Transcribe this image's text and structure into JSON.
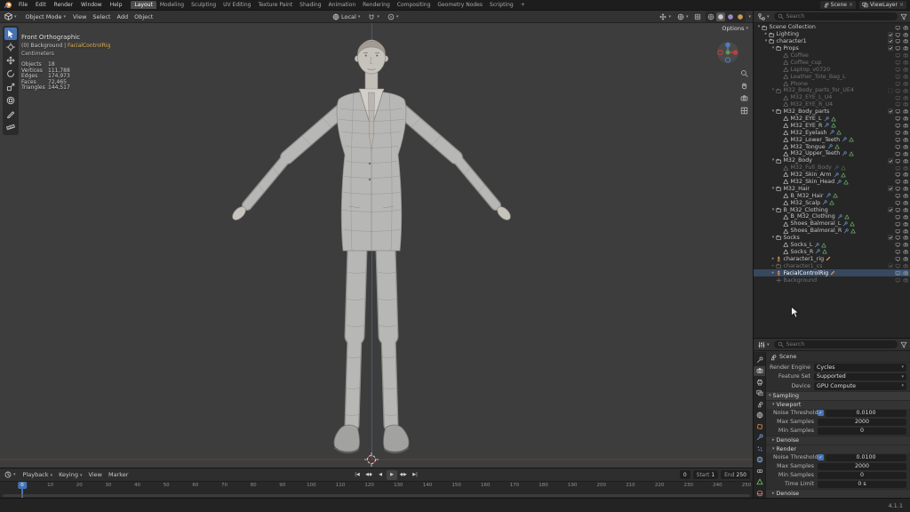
{
  "colors": {
    "accent": "#4772b3",
    "object_orange": "#e8954f",
    "modifier_blue": "#7aa5e0",
    "data_green": "#6fc96f",
    "material_pink": "#e07a7a",
    "selection_bg": "#4d73a6"
  },
  "topbar": {
    "menus": [
      "File",
      "Edit",
      "Render",
      "Window",
      "Help"
    ],
    "workspaces": [
      "Layout",
      "Modeling",
      "Sculpting",
      "UV Editing",
      "Texture Paint",
      "Shading",
      "Animation",
      "Rendering",
      "Compositing",
      "Geometry Nodes",
      "Scripting",
      "+"
    ],
    "active_workspace": "Layout",
    "scene_label": "Scene",
    "viewlayer_label": "ViewLayer"
  },
  "viewport_header": {
    "mode": "Object Mode",
    "menus": [
      "View",
      "Select",
      "Add",
      "Object"
    ],
    "orientation": "Local",
    "options_label": "Options"
  },
  "tools": [
    "select-box",
    "cursor",
    "move",
    "rotate",
    "scale",
    "transform",
    "annotate",
    "measure"
  ],
  "viewport": {
    "view_label": "Front Orthographic",
    "context_prefix": "(0) Background | ",
    "context_object": "FacialControlRig",
    "units_label": "Centimeters",
    "stats": [
      {
        "label": "Objects",
        "value": "18"
      },
      {
        "label": "Vertices",
        "value": "111,788"
      },
      {
        "label": "Edges",
        "value": "174,973"
      },
      {
        "label": "Faces",
        "value": "72,465"
      },
      {
        "label": "Triangles",
        "value": "144,517"
      }
    ]
  },
  "outliner": {
    "search_placeholder": "Search",
    "rows": [
      {
        "name": "Scene Collection",
        "d": 0,
        "t": "collection",
        "exp": "open"
      },
      {
        "name": "Lighting",
        "d": 1,
        "t": "collection",
        "exp": "closed",
        "check": true
      },
      {
        "name": "character1",
        "d": 1,
        "t": "collection",
        "exp": "open",
        "check": true
      },
      {
        "name": "Props",
        "d": 2,
        "t": "collection",
        "exp": "open",
        "check": true
      },
      {
        "name": "Coffee",
        "d": 3,
        "t": "mesh",
        "dim": true
      },
      {
        "name": "Coffee_cup",
        "d": 3,
        "t": "mesh",
        "dim": true
      },
      {
        "name": "Laptop_v0720",
        "d": 3,
        "t": "mesh",
        "dim": true
      },
      {
        "name": "Leather_Tote_Bag_L",
        "d": 3,
        "t": "mesh",
        "dim": true
      },
      {
        "name": "Phone",
        "d": 3,
        "t": "mesh",
        "dim": true
      },
      {
        "name": "M32_Body_parts_for_UE4",
        "d": 2,
        "t": "collection",
        "exp": "open",
        "dim": true,
        "check": false
      },
      {
        "name": "M32_EYE_L_U4",
        "d": 3,
        "t": "mesh",
        "dim": true
      },
      {
        "name": "M32_EYE_R_U4",
        "d": 3,
        "t": "mesh",
        "dim": true
      },
      {
        "name": "M32_Body_parts",
        "d": 2,
        "t": "collection",
        "exp": "open",
        "check": true
      },
      {
        "name": "M32_EYE_L",
        "d": 3,
        "t": "mesh",
        "badges": [
          "modifier",
          "data"
        ]
      },
      {
        "name": "M32_EYE_R",
        "d": 3,
        "t": "mesh",
        "badges": [
          "modifier",
          "data"
        ]
      },
      {
        "name": "M32_Eyelash",
        "d": 3,
        "t": "mesh",
        "badges": [
          "modifier",
          "data"
        ]
      },
      {
        "name": "M32_Lower_Teeth",
        "d": 3,
        "t": "mesh",
        "badges": [
          "modifier",
          "data"
        ]
      },
      {
        "name": "M32_Tongue",
        "d": 3,
        "t": "mesh",
        "badges": [
          "modifier",
          "data"
        ]
      },
      {
        "name": "M32_Upper_Teeth",
        "d": 3,
        "t": "mesh",
        "badges": [
          "modifier",
          "data"
        ]
      },
      {
        "name": "M32_Body",
        "d": 2,
        "t": "collection",
        "exp": "open",
        "check": true
      },
      {
        "name": "M32_Full_Body",
        "d": 3,
        "t": "mesh",
        "dim": true,
        "badges": [
          "modifier",
          "data"
        ]
      },
      {
        "name": "M32_Skin_Arm",
        "d": 3,
        "t": "mesh",
        "badges": [
          "modifier",
          "data"
        ]
      },
      {
        "name": "M32_Skin_Head",
        "d": 3,
        "t": "mesh",
        "badges": [
          "modifier",
          "data"
        ]
      },
      {
        "name": "M32_Hair",
        "d": 2,
        "t": "collection",
        "exp": "open",
        "check": true
      },
      {
        "name": "B_M32_Hair",
        "d": 3,
        "t": "mesh",
        "badges": [
          "modifier",
          "data"
        ]
      },
      {
        "name": "M32_Scalp",
        "d": 3,
        "t": "mesh",
        "badges": [
          "modifier",
          "data"
        ]
      },
      {
        "name": "B_M32_Clothing",
        "d": 2,
        "t": "collection",
        "exp": "open",
        "check": true
      },
      {
        "name": "B_M32_Clothing",
        "d": 3,
        "t": "mesh",
        "badges": [
          "modifier",
          "data"
        ]
      },
      {
        "name": "Shoes_Balmoral_L",
        "d": 3,
        "t": "mesh",
        "badges": [
          "modifier",
          "data"
        ]
      },
      {
        "name": "Shoes_Balmoral_R",
        "d": 3,
        "t": "mesh",
        "badges": [
          "modifier",
          "data"
        ]
      },
      {
        "name": "Socks",
        "d": 2,
        "t": "collection",
        "exp": "open",
        "check": true
      },
      {
        "name": "Socks_L",
        "d": 3,
        "t": "mesh",
        "badges": [
          "modifier",
          "data"
        ]
      },
      {
        "name": "Socks_R",
        "d": 3,
        "t": "mesh",
        "badges": [
          "modifier",
          "data"
        ]
      },
      {
        "name": "character1_rig",
        "d": 2,
        "t": "armature",
        "exp": "closed",
        "badges": [
          "pose"
        ]
      },
      {
        "name": "character1_cs",
        "d": 2,
        "t": "collection",
        "exp": "closed",
        "dim": true,
        "check": true
      },
      {
        "name": "FacialControlRig",
        "d": 2,
        "t": "armature",
        "exp": "closed",
        "sel": true,
        "badges": [
          "pose"
        ]
      },
      {
        "name": "Background",
        "d": 2,
        "t": "empty",
        "dim": true
      }
    ]
  },
  "properties": {
    "search_placeholder": "Search",
    "breadcrumb": "Scene",
    "active_tab": "render",
    "tabs": [
      {
        "id": "tool",
        "icon": "wrench",
        "color": "#b0b0b0"
      },
      {
        "id": "render",
        "icon": "camera",
        "color": "#c8c8c8"
      },
      {
        "id": "output",
        "icon": "printer",
        "color": "#b0b0b0"
      },
      {
        "id": "view-layer",
        "icon": "images",
        "color": "#b0b0b0"
      },
      {
        "id": "scene",
        "icon": "scene",
        "color": "#b0b0b0"
      },
      {
        "id": "world",
        "icon": "globe",
        "color": "#b0b0b0"
      },
      {
        "id": "object",
        "icon": "object",
        "color": "#e8954f"
      },
      {
        "id": "modifiers",
        "icon": "wrench",
        "color": "#7aa5e0"
      },
      {
        "id": "particles",
        "icon": "particles",
        "color": "#7aa5e0"
      },
      {
        "id": "physics",
        "icon": "physics",
        "color": "#7aa5e0"
      },
      {
        "id": "constraints",
        "icon": "constraints",
        "color": "#b0b0b0"
      },
      {
        "id": "data",
        "icon": "mesh",
        "color": "#6fc96f"
      },
      {
        "id": "material",
        "icon": "material",
        "color": "#e07a7a"
      }
    ],
    "config_rows": [
      {
        "label": "Render Engine",
        "value": "Cycles",
        "dropdown": true
      },
      {
        "label": "Feature Set",
        "value": "Supported",
        "dropdown": true
      },
      {
        "label": "Device",
        "value": "GPU Compute",
        "dropdown": true
      }
    ],
    "panel_rows": [
      {
        "kind": "section",
        "label": "Sampling",
        "open": true,
        "level": 0
      },
      {
        "kind": "section",
        "label": "Viewport",
        "open": true,
        "level": 1
      },
      {
        "kind": "prop",
        "label": "Noise Threshold",
        "value": "0.0100",
        "checkbox": true
      },
      {
        "kind": "prop",
        "label": "Max Samples",
        "value": "2000"
      },
      {
        "kind": "prop",
        "label": "Min Samples",
        "value": "0"
      },
      {
        "kind": "section",
        "label": "Denoise",
        "open": false,
        "level": 1
      },
      {
        "kind": "section",
        "label": "Render",
        "open": true,
        "level": 1
      },
      {
        "kind": "prop",
        "label": "Noise Threshold",
        "value": "0.0100",
        "checkbox": true
      },
      {
        "kind": "prop",
        "label": "Max Samples",
        "value": "2000"
      },
      {
        "kind": "prop",
        "label": "Min Samples",
        "value": "0"
      },
      {
        "kind": "prop",
        "label": "Time Limit",
        "value": "0 s"
      },
      {
        "kind": "section",
        "label": "Denoise",
        "open": false,
        "level": 1
      }
    ]
  },
  "timeline": {
    "menus": [
      {
        "label": "Playback",
        "caret": true
      },
      {
        "label": "Keying",
        "caret": true
      },
      {
        "label": "View"
      },
      {
        "label": "Marker"
      }
    ],
    "transport": [
      {
        "id": "jump-start",
        "glyph": "|◀"
      },
      {
        "id": "prev-keyframe",
        "glyph": "◀◆"
      },
      {
        "id": "play-reverse",
        "glyph": "◀"
      },
      {
        "id": "play",
        "glyph": "▶"
      },
      {
        "id": "next-keyframe",
        "glyph": "◆▶"
      },
      {
        "id": "jump-end",
        "glyph": "▶|"
      }
    ],
    "frame": "0",
    "current_frame": 0,
    "start_label": "Start",
    "start_value": "1",
    "end_label": "End",
    "end_value": "250",
    "ruler_frames": [
      10,
      20,
      30,
      40,
      50,
      60,
      70,
      80,
      90,
      100,
      110,
      120,
      130,
      140,
      150,
      160,
      170,
      180,
      190,
      200,
      210,
      220,
      230,
      240,
      250
    ]
  },
  "statusbar": {
    "version": "4.1.1"
  }
}
